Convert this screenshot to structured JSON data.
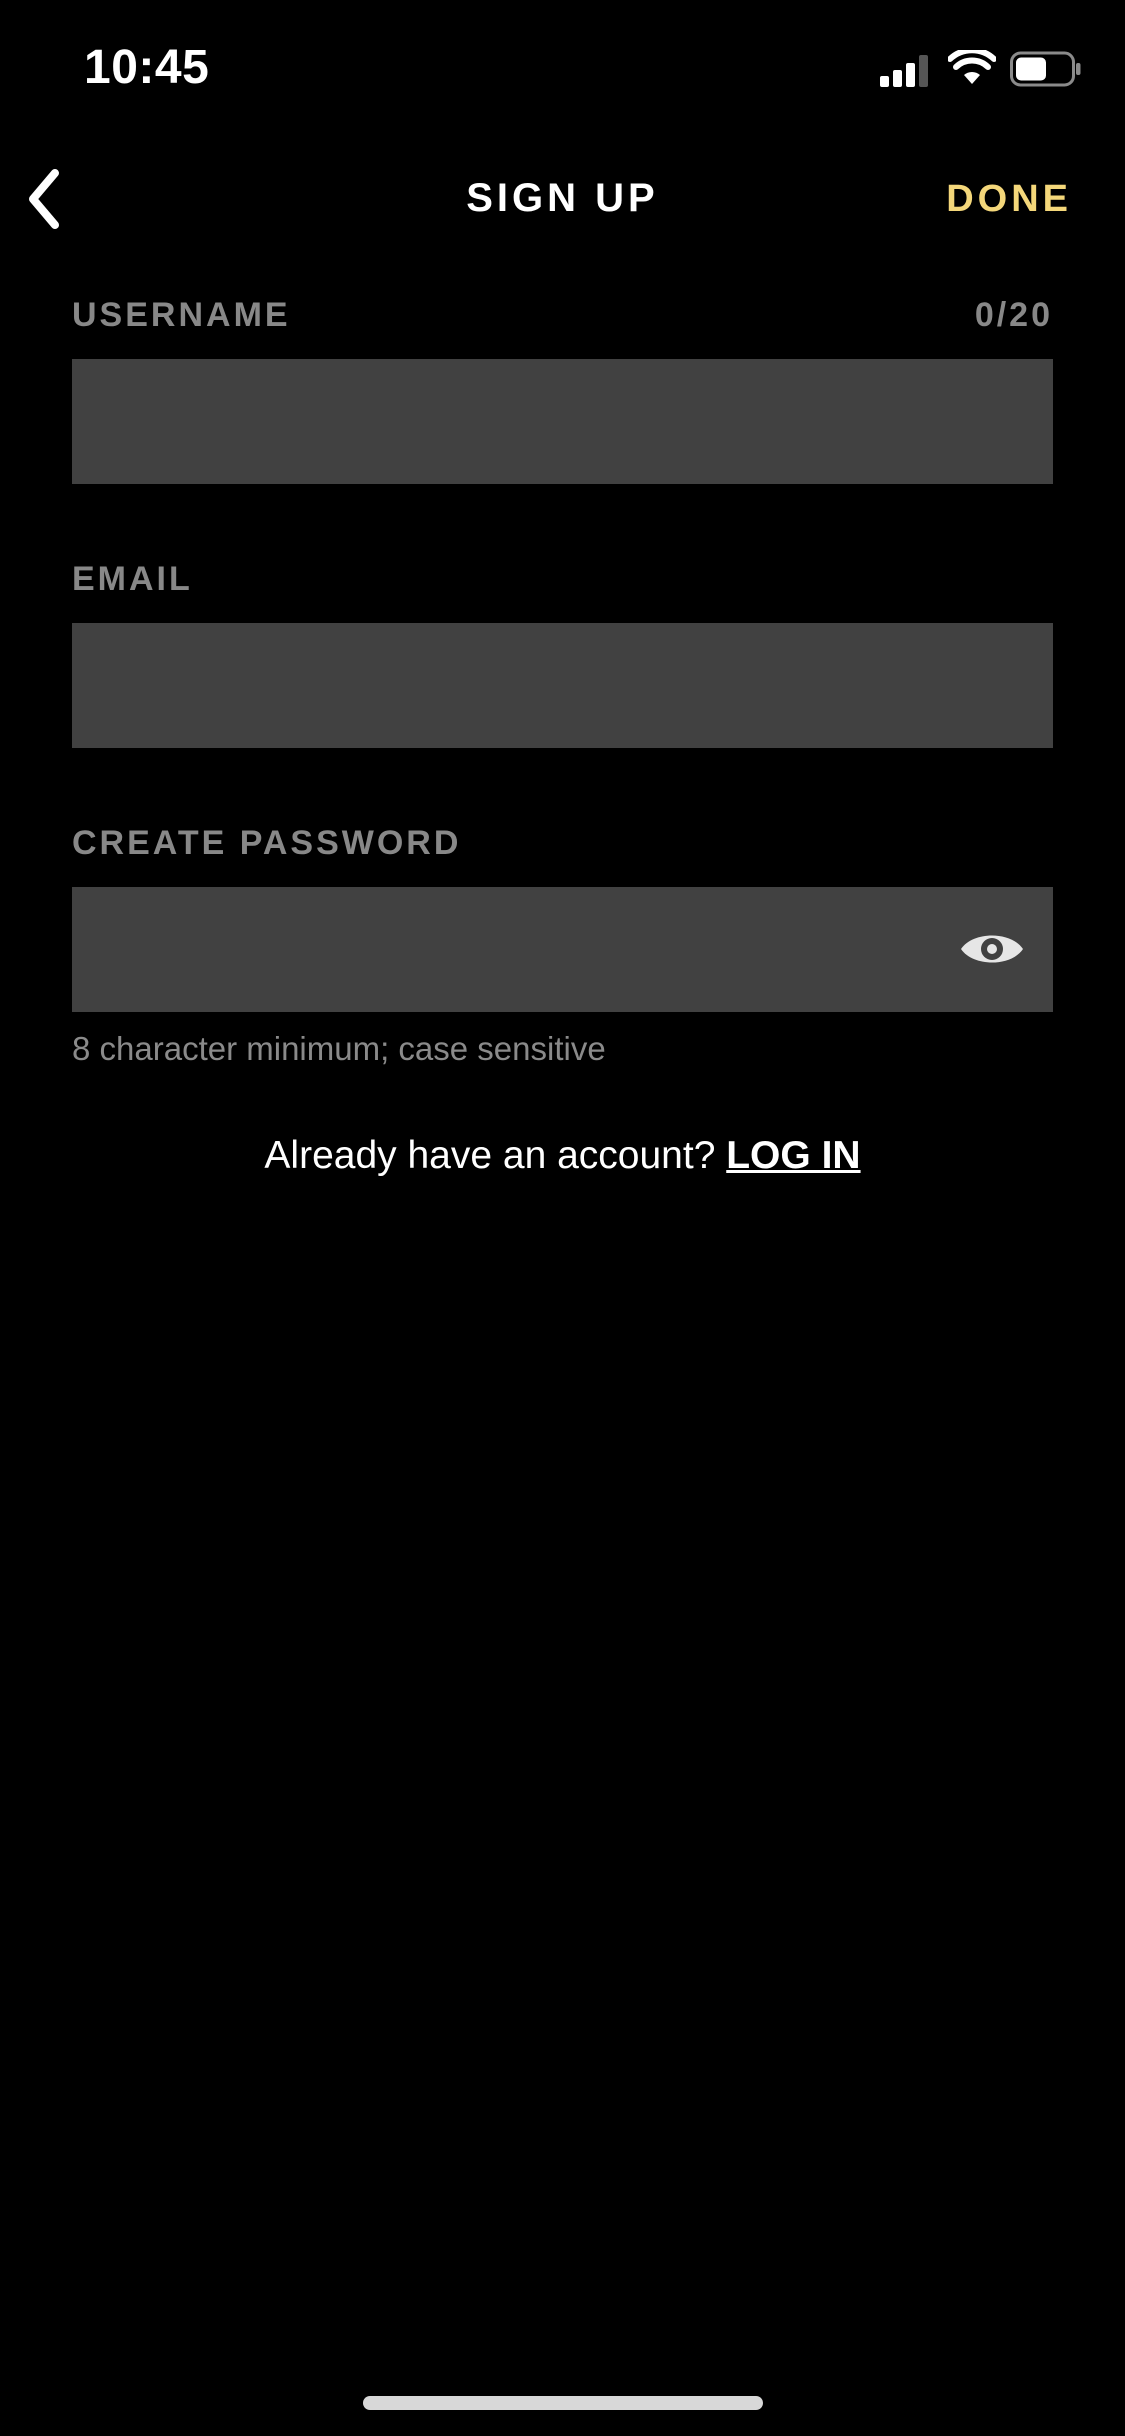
{
  "status_bar": {
    "time": "10:45",
    "signal_icon": "cellular-signal-icon",
    "wifi_icon": "wifi-icon",
    "battery_icon": "battery-icon"
  },
  "nav": {
    "back_icon": "chevron-left-icon",
    "title": "SIGN UP",
    "done_label": "DONE",
    "done_color": "#f4d77a"
  },
  "form": {
    "username": {
      "label": "USERNAME",
      "counter": "0/20",
      "value": "",
      "placeholder": ""
    },
    "email": {
      "label": "EMAIL",
      "value": "",
      "placeholder": ""
    },
    "password": {
      "label": "CREATE PASSWORD",
      "value": "",
      "placeholder": "",
      "toggle_icon": "eye-icon",
      "hint": "8 character minimum; case sensitive"
    }
  },
  "login_prompt": {
    "text": "Already have an account?",
    "link_label": "LOG IN"
  },
  "colors": {
    "background": "#000000",
    "input_fill": "#414141",
    "label": "#888888",
    "accent": "#f4d77a"
  }
}
